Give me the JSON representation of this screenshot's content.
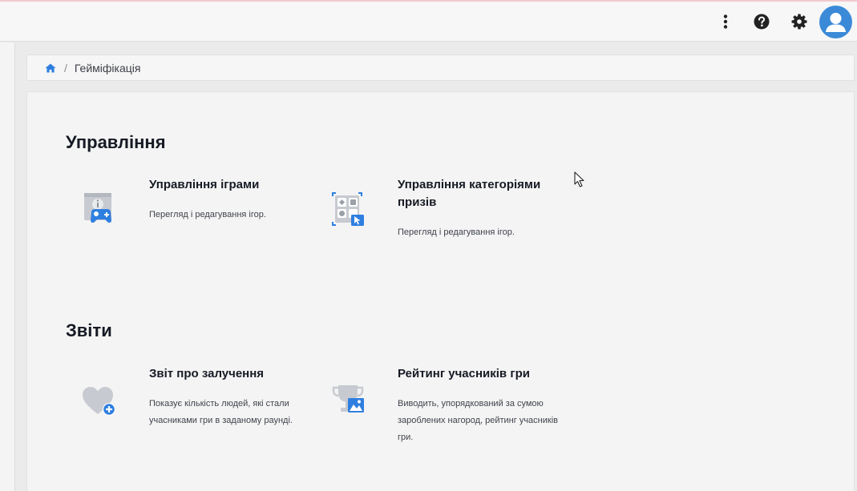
{
  "header": {
    "icons": [
      "more-vertical-icon",
      "help-icon",
      "gear-icon",
      "user-avatar-icon"
    ]
  },
  "breadcrumb": {
    "home_icon": "home-icon",
    "separator": "/",
    "current": "Гейміфікація"
  },
  "sections": {
    "management": {
      "title": "Управління",
      "cards": [
        {
          "title": "Управління іграми",
          "description": "Перегляд і редагування ігор.",
          "icon": "game-controller-icon"
        },
        {
          "title": "Управління категоріями призів",
          "description": "Перегляд і редагування ігор.",
          "icon": "prize-categories-icon"
        }
      ]
    },
    "reports": {
      "title": "Звіти",
      "cards": [
        {
          "title": "Звіт про залучення",
          "description": "Показує кількість людей, які стали учасниками гри в заданому раунді.",
          "icon": "heart-plus-icon"
        },
        {
          "title": "Рейтинг учасників гри",
          "description": "Виводить, упорядкований за сумою зароблених нагород, рейтинг учасників гри.",
          "icon": "trophy-icon"
        }
      ]
    }
  },
  "colors": {
    "accent": "#3b8ad8",
    "icon_gray": "#b9bdc4",
    "icon_blue": "#2f7fe0"
  }
}
